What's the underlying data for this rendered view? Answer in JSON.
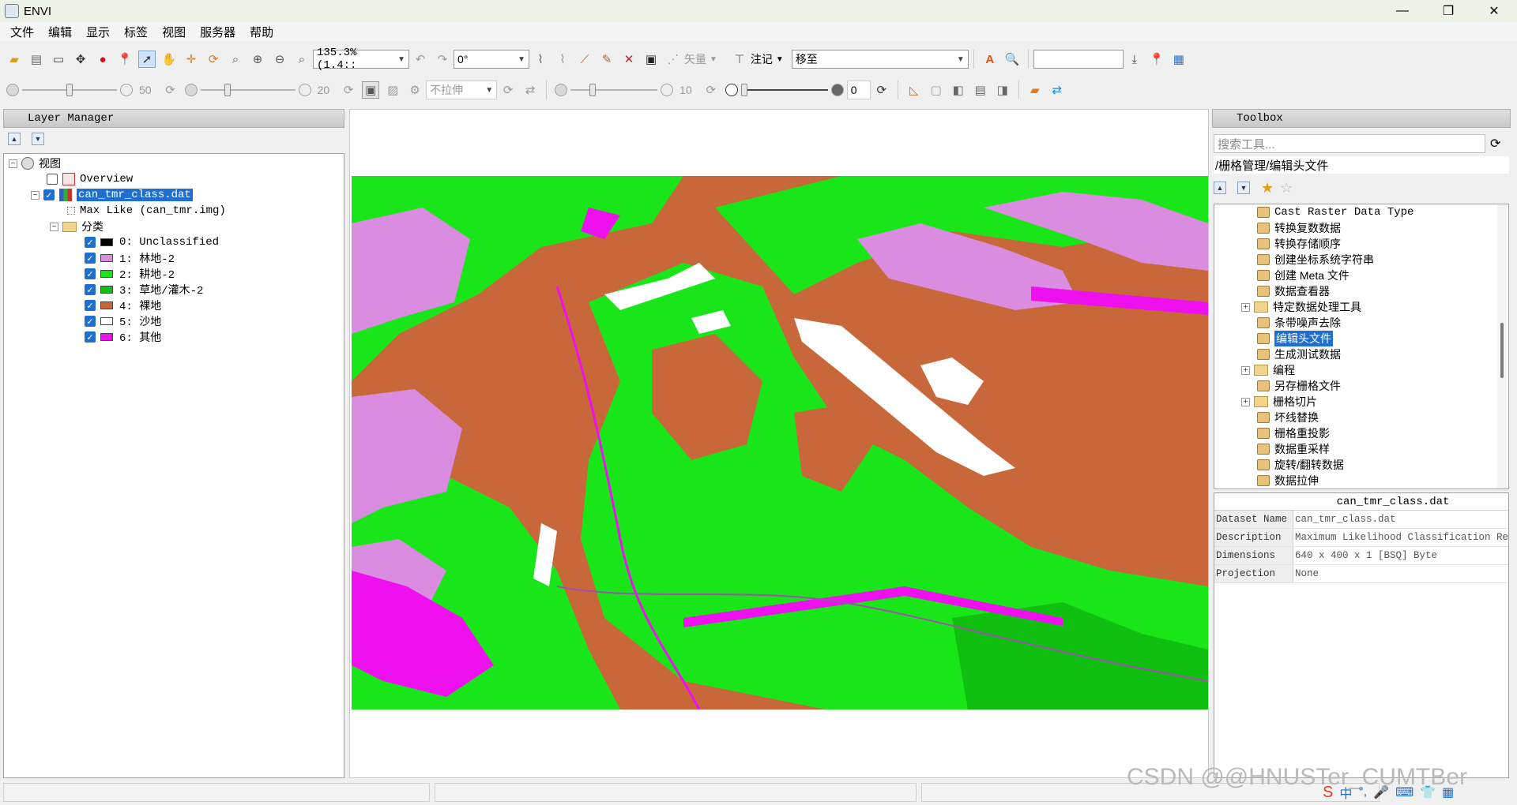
{
  "window": {
    "title": "ENVI",
    "minimize": "—",
    "maximize": "❐",
    "close": "✕"
  },
  "menu": [
    "文件",
    "编辑",
    "显示",
    "标签",
    "视图",
    "服务器",
    "帮助"
  ],
  "toolbar1": {
    "zoom_value": "135.3% (1.4::",
    "rotation_value": "0°",
    "vector_label": "矢量",
    "annotation_label": "注记",
    "goto_value": "移至",
    "search_value": ""
  },
  "toolbar2": {
    "brightness_value": "50",
    "contrast_value": "20",
    "stretch_value": "不拉伸",
    "sharpen_value": "10",
    "transparency_value": "0"
  },
  "layer_manager": {
    "title": "Layer Manager",
    "view_label": "视图",
    "overview_label": "Overview",
    "dataset_label": "can_tmr_class.dat",
    "maxlike_label": "Max Like (can_tmr.img)",
    "class_folder_label": "分类",
    "classes": [
      {
        "label": "0: Unclassified",
        "color": "#000000"
      },
      {
        "label": "1: 林地-2",
        "color": "#d98ce0"
      },
      {
        "label": "2: 耕地-2",
        "color": "#19e619"
      },
      {
        "label": "3: 草地/灌木-2",
        "color": "#10c010"
      },
      {
        "label": "4: 裸地",
        "color": "#c8683a"
      },
      {
        "label": "5: 沙地",
        "color": "#ffffff"
      },
      {
        "label": "6: 其他",
        "color": "#ee10ee"
      }
    ]
  },
  "toolbox": {
    "title": "Toolbox",
    "search_placeholder": "搜索工具...",
    "path": "/栅格管理/编辑头文件",
    "items": [
      {
        "label": "Cast Raster Data Type",
        "type": "tool"
      },
      {
        "label": "转换复数数据",
        "type": "tool"
      },
      {
        "label": "转换存储顺序",
        "type": "tool"
      },
      {
        "label": "创建坐标系统字符串",
        "type": "tool"
      },
      {
        "label": "创建 Meta 文件",
        "type": "tool"
      },
      {
        "label": "数据查看器",
        "type": "tool"
      },
      {
        "label": "特定数据处理工具",
        "type": "folder"
      },
      {
        "label": "条带噪声去除",
        "type": "tool"
      },
      {
        "label": "编辑头文件",
        "type": "tool",
        "selected": true
      },
      {
        "label": "生成测试数据",
        "type": "tool"
      },
      {
        "label": "编程",
        "type": "folder"
      },
      {
        "label": "另存栅格文件",
        "type": "tool"
      },
      {
        "label": "栅格切片",
        "type": "folder"
      },
      {
        "label": "坏线替换",
        "type": "tool"
      },
      {
        "label": "栅格重投影",
        "type": "tool"
      },
      {
        "label": "数据重采样",
        "type": "tool"
      },
      {
        "label": "旋转/翻转数据",
        "type": "tool"
      },
      {
        "label": "数据拉伸",
        "type": "tool"
      }
    ]
  },
  "metadata": {
    "header": "can_tmr_class.dat",
    "rows": [
      {
        "key": "Dataset Name",
        "value": "can_tmr_class.dat"
      },
      {
        "key": "Description",
        "value": "Maximum Likelihood Classification Re"
      },
      {
        "key": "Dimensions",
        "value": "640 x 400 x 1 [BSQ] Byte"
      },
      {
        "key": "Projection",
        "value": "None"
      }
    ]
  },
  "watermark": "CSDN @@HNUSTer_CUMTBer",
  "colors": {
    "selection": "#1f6fd1",
    "bare": "#c8683a",
    "forest": "#d98ce0",
    "crop": "#19e619",
    "other": "#ee10ee"
  }
}
